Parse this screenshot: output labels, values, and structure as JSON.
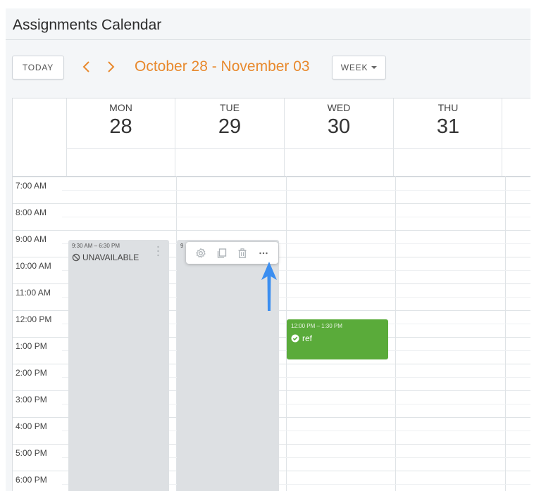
{
  "app": {
    "title": "Assignments Calendar"
  },
  "toolbar": {
    "today_label": "TODAY",
    "range_label": "October 28 - November 03",
    "view_label": "WEEK"
  },
  "colors": {
    "accent": "#e8892d",
    "event_green": "#5aab3a",
    "unavailable": "#dde0e3",
    "annotation_arrow": "#3b8ef0"
  },
  "days": [
    {
      "dow": "MON",
      "num": "28"
    },
    {
      "dow": "TUE",
      "num": "29"
    },
    {
      "dow": "WED",
      "num": "30"
    },
    {
      "dow": "THU",
      "num": "31"
    }
  ],
  "times": [
    "7:00 AM",
    "8:00 AM",
    "9:00 AM",
    "10:00 AM",
    "11:00 AM",
    "12:00 PM",
    "1:00 PM",
    "2:00 PM",
    "3:00 PM",
    "4:00 PM",
    "5:00 PM",
    "6:00 PM"
  ],
  "events": {
    "mon_unavailable": {
      "time": "9:30 AM – 6:30 PM",
      "label": "UNAVAILABLE"
    },
    "tue_unavailable": {
      "time": "9"
    },
    "wed_event": {
      "time": "12:00 PM – 1:30 PM",
      "label": "ref"
    }
  },
  "event_actions": [
    "settings-icon",
    "copy-icon",
    "delete-icon",
    "more-icon"
  ]
}
